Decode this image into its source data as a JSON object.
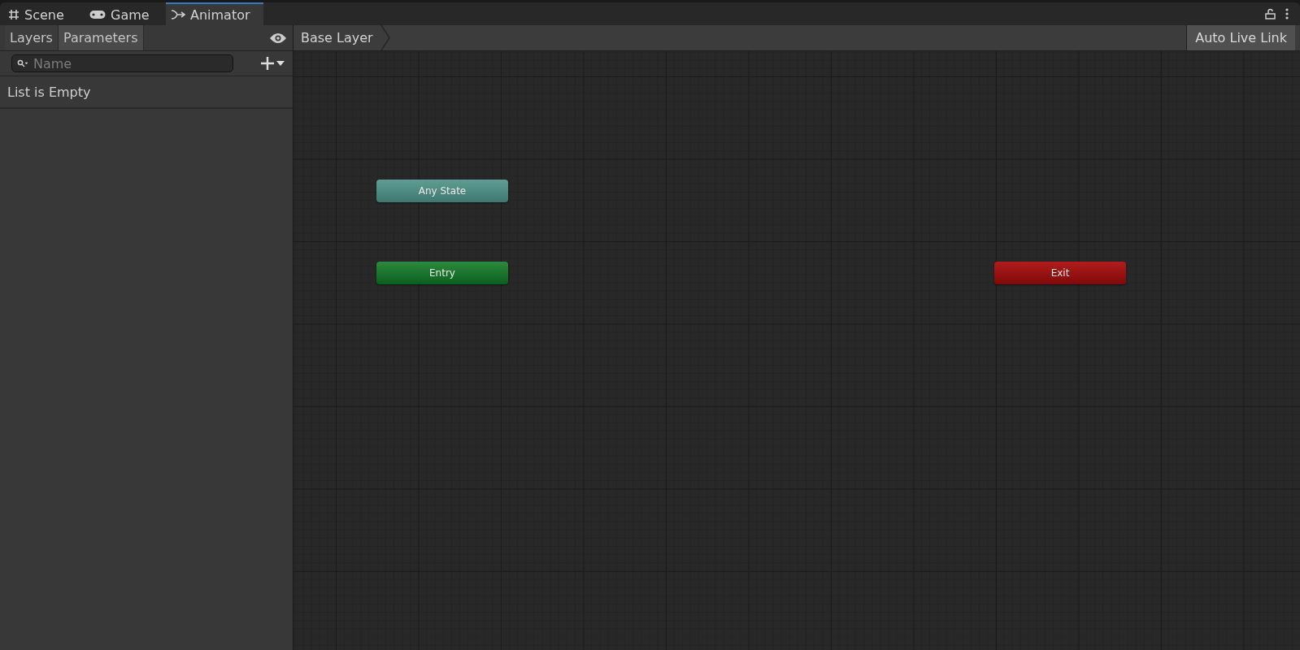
{
  "tabs": [
    {
      "label": "Scene",
      "kind": "scene",
      "selected": false
    },
    {
      "label": "Game",
      "kind": "game",
      "selected": false
    },
    {
      "label": "Animator",
      "kind": "animator",
      "selected": true
    }
  ],
  "sidebar": {
    "tabs": [
      {
        "label": "Layers",
        "selected": false
      },
      {
        "label": "Parameters",
        "selected": true
      }
    ],
    "search": {
      "placeholder": "Name"
    },
    "empty_text": "List is Empty"
  },
  "breadcrumb": "Base Layer",
  "auto_live_link": {
    "label": "Auto Live Link",
    "on": true
  },
  "nodes": [
    {
      "label": "Any State",
      "kind": "any"
    },
    {
      "label": "Entry",
      "kind": "entry"
    },
    {
      "label": "Exit",
      "kind": "exit"
    }
  ]
}
